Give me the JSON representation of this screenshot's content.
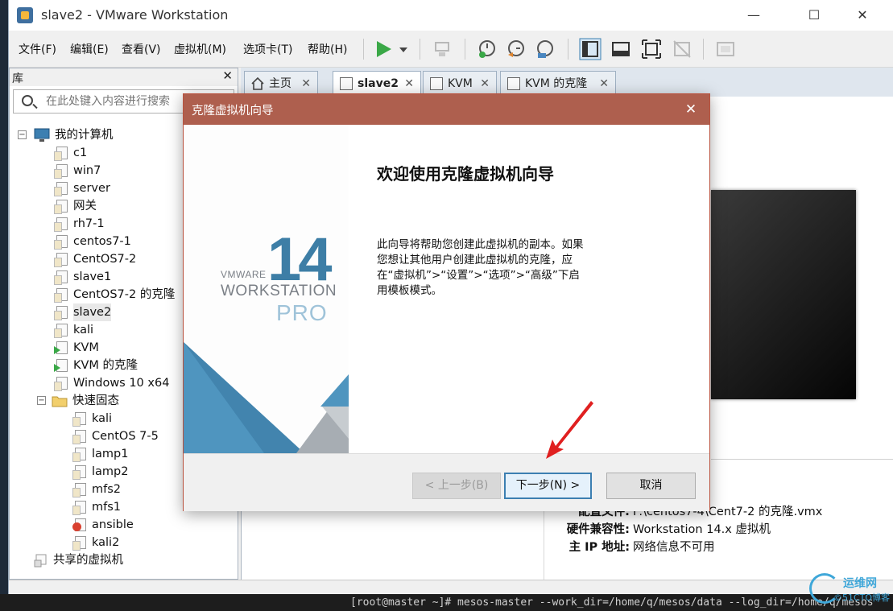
{
  "window": {
    "title": "slave2 - VMware Workstation"
  },
  "menu": [
    "文件(F)",
    "编辑(E)",
    "查看(V)",
    "虚拟机(M)",
    "选项卡(T)",
    "帮助(H)"
  ],
  "library": {
    "title": "库",
    "search_placeholder": "在此处键入内容进行搜索",
    "root": "我的计算机",
    "vms": [
      "c1",
      "win7",
      "server",
      "网关",
      "rh7-1",
      "centos7-1",
      "CentOS7-2",
      "slave1",
      "CentOS7-2 的克隆",
      "slave2",
      "kali",
      "KVM",
      "KVM 的克隆",
      "Windows 10 x64"
    ],
    "folder": "快速固态",
    "folder_vms": [
      "kali",
      "CentOS 7-5",
      "lamp1",
      "lamp2",
      "mfs2",
      "mfs1",
      "ansible",
      "kali2"
    ],
    "shared": "共享的虚拟机"
  },
  "tabs": [
    "主页",
    "slave2",
    "KVM",
    "KVM 的克隆"
  ],
  "dialog": {
    "title": "克隆虚拟机向导",
    "heading": "欢迎使用克隆虚拟机向导",
    "description": "此向导将帮助您创建此虚拟机的副本。如果您想让其他用户创建此虚拟机的克隆，应在“虚拟机”>“设置”>“选项”>“高级”下启用模板模式。",
    "brand_version": "14",
    "brand_vendor": "VMWARE",
    "brand_product": "WORKSTATION",
    "brand_edition": "PRO",
    "buttons": {
      "back": "< 上一步(B)",
      "next": "下一步(N) >",
      "cancel": "取消"
    }
  },
  "details": [
    {
      "key": "配置文件:",
      "value": "F:\\centos7-4\\Cent7-2 的克隆.vmx"
    },
    {
      "key": "硬件兼容性:",
      "value": "Workstation 14.x 虚拟机"
    },
    {
      "key": "主 IP 地址:",
      "value": "网络信息不可用"
    }
  ],
  "terminal_line": "[root@master ~]# mesos-master --work_dir=/home/q/mesos/data --log_dir=/home/q/mesos",
  "watermark": {
    "line1": "运维网",
    "line2": "©51CTO博客"
  },
  "colors": {
    "dialog_title": "#ae5f4e",
    "accent": "#3c7fb1",
    "play": "#3aa847"
  }
}
